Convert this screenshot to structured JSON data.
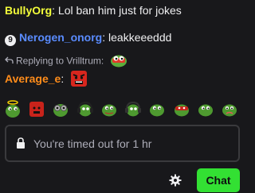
{
  "messages": [
    {
      "username": "BullyOrg",
      "username_color": "#f4ff3a",
      "text": "Lol ban him just for jokes"
    },
    {
      "badge": "9",
      "username": "Nerogen_onorg",
      "username_color": "#5a8cff",
      "text": "leakkeeeddd"
    }
  ],
  "reply": {
    "label": "Replying to Vrilltrum:",
    "icon": "reply-arrow-icon",
    "emote": "pepe-emote"
  },
  "reply_message": {
    "username": "Average_e",
    "username_color": "#ff8c1a",
    "emote": "angry-red-emote"
  },
  "emote_row": [
    "pepe-halo-emote",
    "angry-red-emote",
    "pepe-goggles-emote",
    "pepe-headphones-emote",
    "pepe-emote",
    "pepe-headphones-emote",
    "pepe-emote",
    "pepe-red-eyes-emote",
    "pepe-emote",
    "pepe-sad-emote"
  ],
  "input": {
    "placeholder": "You're timed out for 1 hr",
    "icon": "lock-icon"
  },
  "toolbar": {
    "settings_icon": "gear-icon",
    "chat_label": "Chat",
    "chat_color": "#33e033"
  }
}
